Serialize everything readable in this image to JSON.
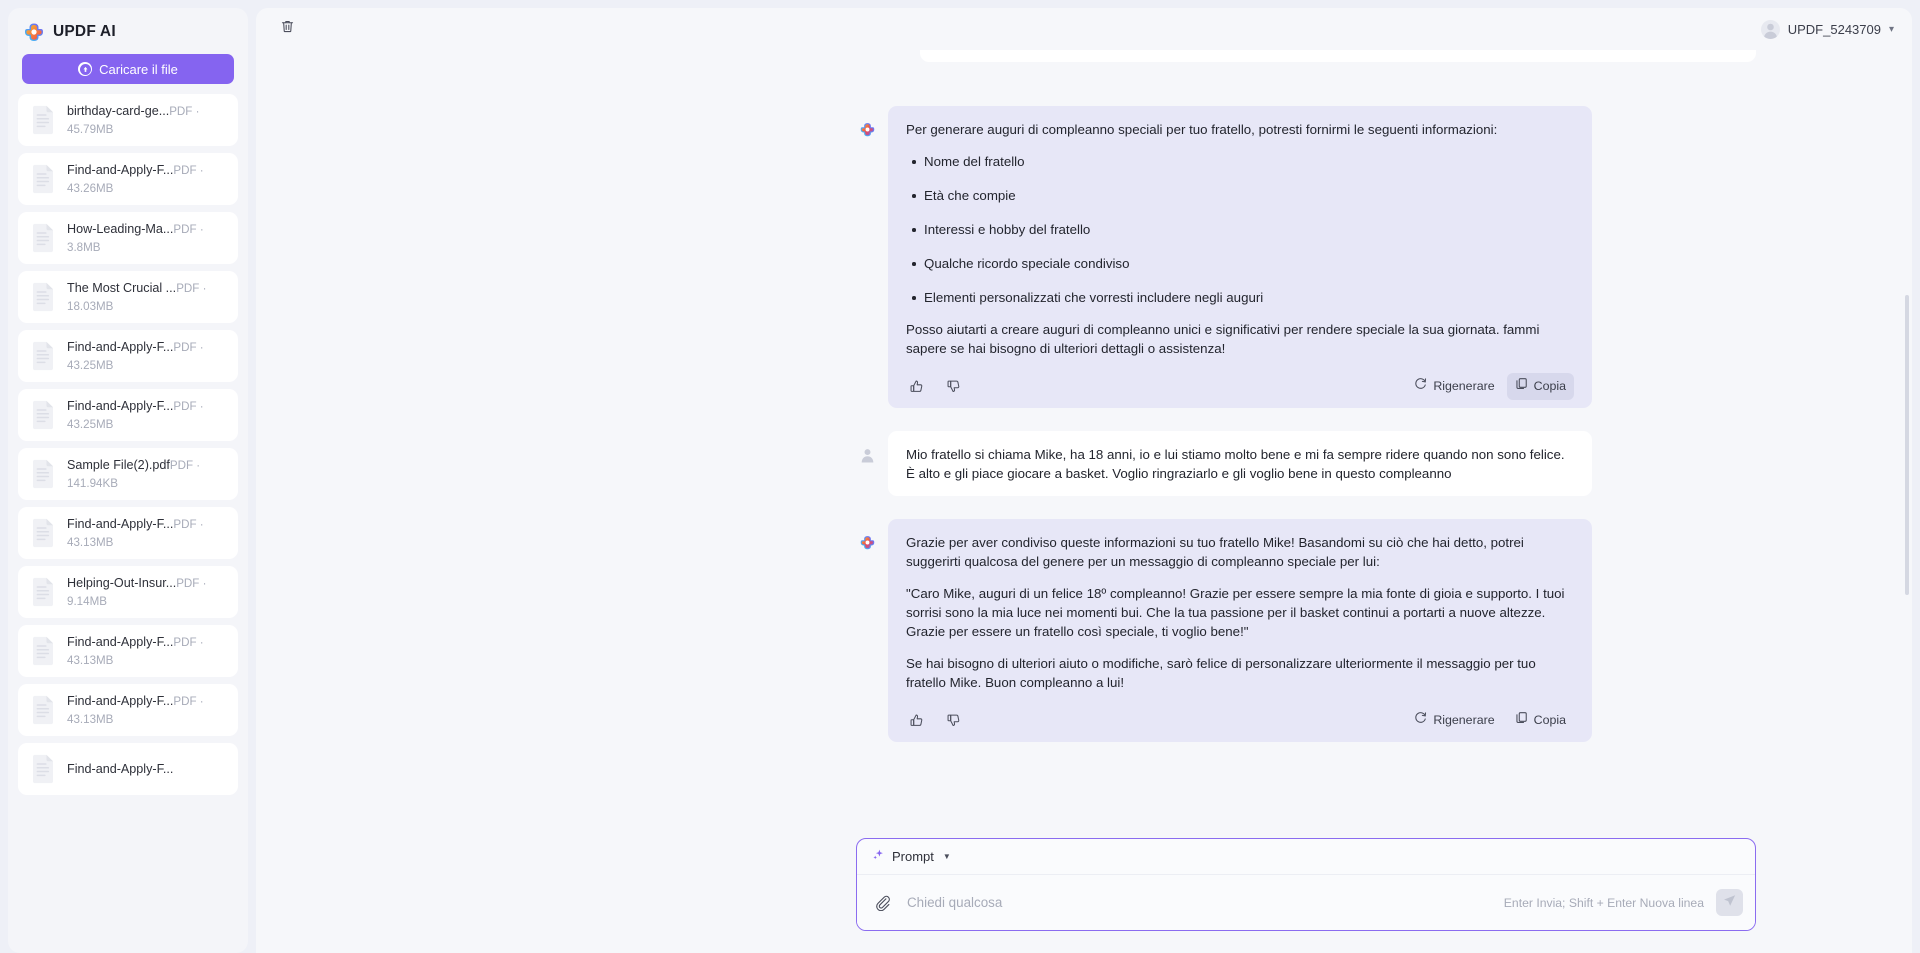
{
  "sidebar": {
    "brand": "UPDF AI",
    "brand_logo_icon": "updf-flower-logo-icon",
    "upload_button": "Caricare il file",
    "upload_icon": "upload-circle-icon",
    "files": [
      {
        "name": "birthday-card-ge...",
        "meta": "PDF · 45.79MB"
      },
      {
        "name": "Find-and-Apply-F...",
        "meta": "PDF · 43.26MB"
      },
      {
        "name": "How-Leading-Ma...",
        "meta": "PDF · 3.8MB"
      },
      {
        "name": "The Most Crucial ...",
        "meta": "PDF · 18.03MB"
      },
      {
        "name": "Find-and-Apply-F...",
        "meta": "PDF · 43.25MB"
      },
      {
        "name": "Find-and-Apply-F...",
        "meta": "PDF · 43.25MB"
      },
      {
        "name": "Sample File(2).pdf",
        "meta": "PDF · 141.94KB"
      },
      {
        "name": "Find-and-Apply-F...",
        "meta": "PDF · 43.13MB"
      },
      {
        "name": "Helping-Out-Insur...",
        "meta": "PDF · 9.14MB"
      },
      {
        "name": "Find-and-Apply-F...",
        "meta": "PDF · 43.13MB"
      },
      {
        "name": "Find-and-Apply-F...",
        "meta": "PDF · 43.13MB"
      },
      {
        "name": "Find-and-Apply-F...",
        "meta": ""
      }
    ]
  },
  "topbar": {
    "trash_icon": "trash-icon",
    "account_name": "UPDF_5243709",
    "account_avatar_icon": "user-avatar-icon",
    "account_caret_icon": "chevron-down-icon"
  },
  "conversation": {
    "assistant_avatar_icon": "updf-ai-avatar-icon",
    "user_avatar_icon": "user-avatar-icon",
    "message1": {
      "intro": "Per generare auguri di compleanno speciali per tuo fratello, potresti fornirmi le seguenti informazioni:",
      "bullets": [
        "Nome del fratello",
        "Età che compie",
        "Interessi e hobby del fratello",
        "Qualche ricordo speciale condiviso",
        "Elementi personalizzati che vorresti includere negli auguri"
      ],
      "outro": "Posso aiutarti a creare auguri di compleanno unici e significativi per rendere speciale la sua giornata. fammi sapere se hai bisogno di ulteriori dettagli o assistenza!"
    },
    "message2": {
      "text": "Mio fratello si chiama Mike, ha 18 anni, io e lui stiamo molto bene e mi fa sempre ridere quando non sono felice. È alto e gli piace giocare a basket. Voglio ringraziarlo e gli voglio bene in questo compleanno"
    },
    "message3": {
      "para1": "Grazie per aver condiviso queste informazioni su tuo fratello Mike! Basandomi su ciò che hai detto, potrei suggerirti qualcosa del genere per un messaggio di compleanno speciale per lui:",
      "para2": "\"Caro Mike, auguri di un felice 18º compleanno! Grazie per essere sempre la mia fonte di gioia e supporto. I tuoi sorrisi sono la mia luce nei momenti bui. Che la tua passione per il basket continui a portarti a nuove altezze. Grazie per essere un fratello così speciale, ti voglio bene!\"",
      "para3": "Se hai bisogno di ulteriori aiuto o modifiche, sarò felice di personalizzare ulteriormente il messaggio per tuo fratello Mike. Buon compleanno a lui!"
    },
    "actions": {
      "thumbs_up_icon": "thumbs-up-icon",
      "thumbs_down_icon": "thumbs-down-icon",
      "regenerate_label": "Rigenerare",
      "regenerate_icon": "refresh-icon",
      "copy_label": "Copia",
      "copy_icon": "copy-icon"
    }
  },
  "composer": {
    "prompt_label": "Prompt",
    "prompt_icon": "sparkle-icon",
    "prompt_caret_icon": "caret-down-icon",
    "attach_icon": "paperclip-icon",
    "input_value": "",
    "input_placeholder": "Chiedi qualcosa",
    "hint": "Enter Invia; Shift + Enter Nuova linea",
    "send_icon": "send-icon"
  },
  "colors": {
    "accent": "#8564f0",
    "ai_bubble": "#e7e7f7",
    "user_bubble": "#ffffff",
    "page_bg": "#eef0f7"
  }
}
